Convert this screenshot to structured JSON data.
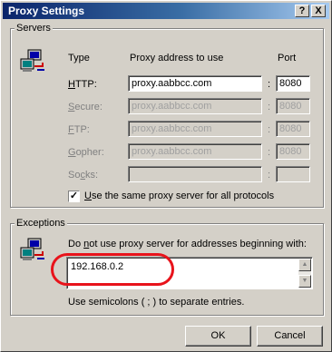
{
  "window": {
    "title": "Proxy Settings",
    "help_button": "?",
    "close_button": "X"
  },
  "servers": {
    "legend": "Servers",
    "col_type": "Type",
    "col_address": "Proxy address to use",
    "col_port": "Port",
    "rows": [
      {
        "label": "HTTP:",
        "address": "proxy.aabbcc.com",
        "port": "8080",
        "enabled": true
      },
      {
        "label": "Secure:",
        "address": "proxy.aabbcc.com",
        "port": "8080",
        "enabled": false
      },
      {
        "label": "FTP:",
        "address": "proxy.aabbcc.com",
        "port": "8080",
        "enabled": false
      },
      {
        "label": "Gopher:",
        "address": "proxy.aabbcc.com",
        "port": "8080",
        "enabled": false
      },
      {
        "label": "Socks:",
        "address": "",
        "port": "",
        "enabled": false
      }
    ],
    "colon": ":",
    "same_proxy_label": "Use the same proxy server for all protocols",
    "same_proxy_checked": true
  },
  "exceptions": {
    "legend": "Exceptions",
    "description": "Do not use proxy server for addresses beginning with:",
    "value": "192.168.0.2",
    "hint": "Use semicolons ( ; ) to separate entries."
  },
  "buttons": {
    "ok": "OK",
    "cancel": "Cancel"
  },
  "colors": {
    "highlight": "#e8131b",
    "titlebar_start": "#0a246a",
    "titlebar_end": "#a6caf0"
  }
}
